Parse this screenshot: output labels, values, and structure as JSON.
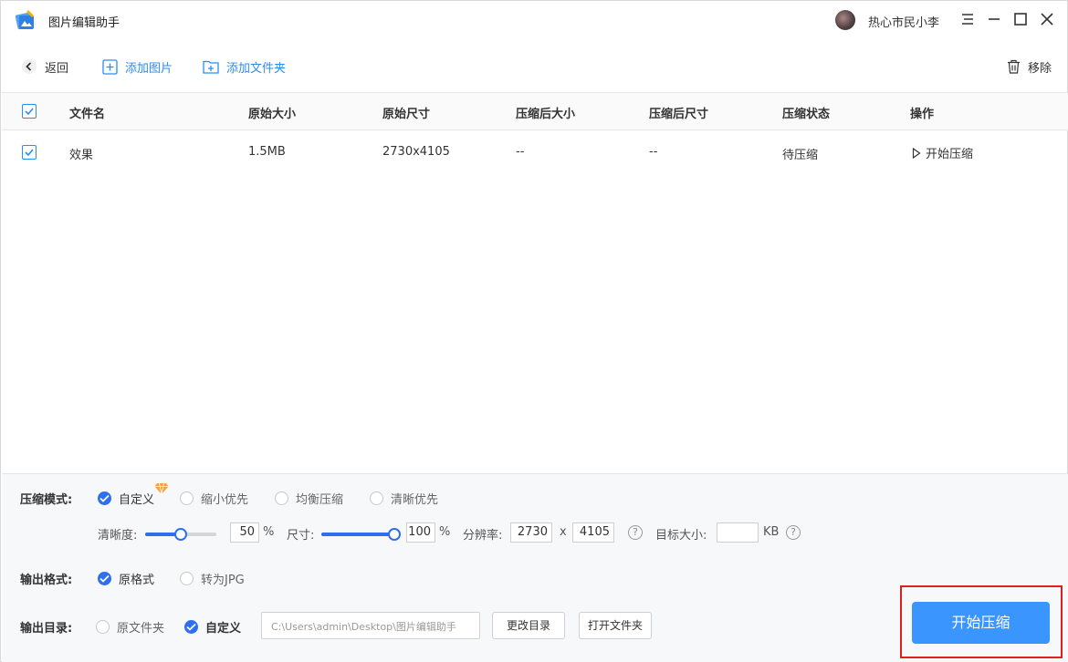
{
  "app": {
    "title": "图片编辑助手"
  },
  "user": {
    "name": "热心市民小李"
  },
  "toolbar": {
    "back": "返回",
    "add_image": "添加图片",
    "add_folder": "添加文件夹",
    "remove": "移除"
  },
  "table": {
    "headers": [
      "文件名",
      "原始大小",
      "原始尺寸",
      "压缩后大小",
      "压缩后尺寸",
      "压缩状态",
      "操作"
    ],
    "rows": [
      {
        "checked": true,
        "name": "效果",
        "size": "1.5MB",
        "dimensions": "2730x4105",
        "compressed_size": "--",
        "compressed_dimensions": "--",
        "status": "待压缩",
        "action": "开始压缩"
      }
    ]
  },
  "settings": {
    "mode_label": "压缩模式:",
    "modes": [
      "自定义",
      "缩小优先",
      "均衡压缩",
      "清晰优先"
    ],
    "selected_mode": "自定义",
    "clarity_label": "清晰度:",
    "clarity_value": "50",
    "clarity_fraction": 0.5,
    "size_label": "尺寸:",
    "size_value": "100",
    "size_fraction": 1.0,
    "percent": "%",
    "resolution_label": "分辨率:",
    "res_w": "2730",
    "res_x": "x",
    "res_h": "4105",
    "target_label": "目标大小:",
    "target_value": "",
    "target_unit": "KB",
    "help": "?",
    "format_label": "输出格式:",
    "formats": [
      "原格式",
      "转为JPG"
    ],
    "selected_format": "原格式",
    "dir_label": "输出目录:",
    "dirs": [
      "原文件夹",
      "自定义"
    ],
    "selected_dir": "自定义",
    "dir_path": "C:\\Users\\admin\\Desktop\\图片编辑助手",
    "change_dir": "更改目录",
    "open_folder": "打开文件夹",
    "start": "开始压缩"
  },
  "colors": {
    "accent": "#2d8cf0",
    "primary_button": "#3b95ff",
    "highlight_border": "#e02020"
  }
}
